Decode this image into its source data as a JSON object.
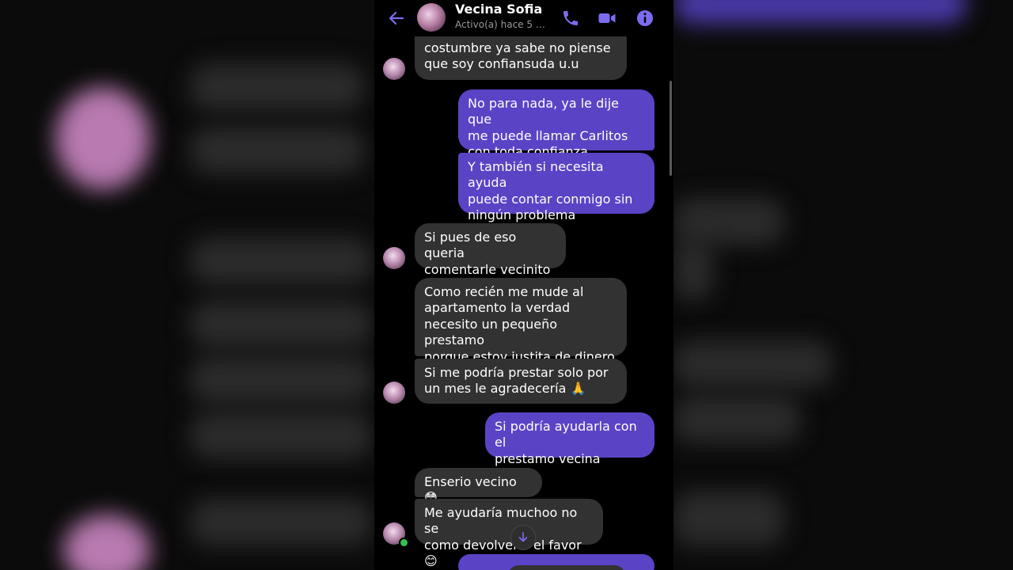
{
  "header": {
    "contact_name": "Vecina Sofia",
    "status": "Activo(a) hace 5 mi…"
  },
  "icons": {
    "back": "arrow-left-icon",
    "call": "phone-icon",
    "video": "video-camera-icon",
    "info": "info-icon",
    "scroll_down": "arrow-down-icon"
  },
  "colors": {
    "accent": "#7b6cf0",
    "outgoing_bubble": "#5b43c6",
    "incoming_bubble": "#323232",
    "online": "#31c24d"
  },
  "messages": [
    {
      "direction": "in",
      "text": "costumbre ya sabe no piense\nque soy confiansuda u.u"
    },
    {
      "direction": "out",
      "text": "No para nada, ya le dije que\nme puede llamar Carlitos\ncon toda confianza"
    },
    {
      "direction": "out",
      "text": "Y también si necesita ayuda\npuede contar conmigo sin\nningún problema"
    },
    {
      "direction": "in",
      "text": "Si pues de eso queria\ncomentarle vecinito"
    },
    {
      "direction": "in",
      "text": "Como recién me mude al\napartamento la verdad\nnecesito un pequeño prestamo\nporque estoy justita de dinero"
    },
    {
      "direction": "in",
      "text": "Si me podría prestar solo por\nun mes le agradecería 🙏"
    },
    {
      "direction": "out",
      "text": "Si podría ayudarla con el\nprestamo vecina"
    },
    {
      "direction": "in",
      "text": "Enserio vecino 😳"
    },
    {
      "direction": "in",
      "text": "Me ayudaría muchoo no se\ncomo devolverle el favor 😊"
    }
  ]
}
